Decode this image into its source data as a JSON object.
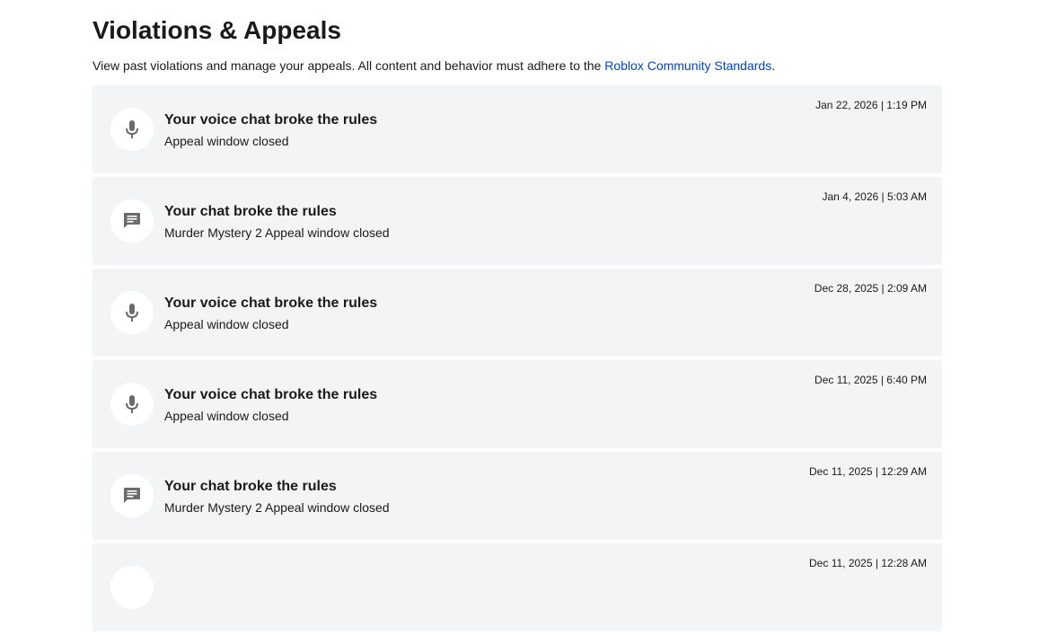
{
  "page": {
    "title": "Violations & Appeals",
    "description_prefix": "View past violations and manage your appeals. All content and behavior must adhere to the ",
    "description_link": "Roblox Community Standards",
    "description_suffix": "."
  },
  "colors": {
    "link": "#0044cc",
    "card_background": "#f3f4f6",
    "icon_color": "#6b6b6b"
  },
  "violations": [
    {
      "icon": "microphone-icon",
      "title": "Your voice chat broke the rules",
      "subtitle": "Appeal window closed",
      "date": "Jan 22, 2026 | 1:19 PM"
    },
    {
      "icon": "chat-bubble-icon",
      "title": "Your chat broke the rules",
      "subtitle": "Murder Mystery 2 Appeal window closed",
      "date": "Jan 4, 2026 | 5:03 AM"
    },
    {
      "icon": "microphone-icon",
      "title": "Your voice chat broke the rules",
      "subtitle": "Appeal window closed",
      "date": "Dec 28, 2025 | 2:09 AM"
    },
    {
      "icon": "microphone-icon",
      "title": "Your voice chat broke the rules",
      "subtitle": "Appeal window closed",
      "date": "Dec 11, 2025 | 6:40 PM"
    },
    {
      "icon": "chat-bubble-icon",
      "title": "Your chat broke the rules",
      "subtitle": "Murder Mystery 2 Appeal window closed",
      "date": "Dec 11, 2025 | 12:29 AM"
    },
    {
      "icon": "",
      "title": "",
      "subtitle": "",
      "date": "Dec 11, 2025 | 12:28 AM"
    }
  ]
}
